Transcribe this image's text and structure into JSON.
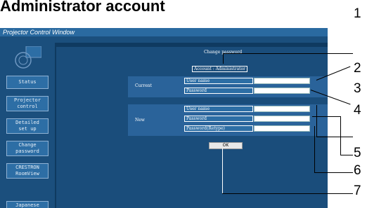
{
  "heading": "Administrator account",
  "window": {
    "title": "Projector Control Window"
  },
  "sidebar": {
    "items": [
      {
        "label": "Status"
      },
      {
        "label": "Projector\ncontrol"
      },
      {
        "label": "Detailed\nset up"
      },
      {
        "label": "Change\npassword"
      },
      {
        "label": "CRESTRON\nRoomView"
      },
      {
        "label": "Japanese"
      }
    ]
  },
  "main": {
    "page_title": "Change password",
    "account": "Account : Administrator",
    "current": {
      "section_label": "Current",
      "username_label": "User name",
      "password_label": "Password",
      "username_value": "",
      "password_value": ""
    },
    "new": {
      "section_label": "New",
      "username_label": "User name",
      "password_label": "Password",
      "retype_label": "Password(Retype)",
      "username_value": "",
      "password_value": "",
      "retype_value": ""
    },
    "ok_label": "OK"
  },
  "callouts": [
    "1",
    "2",
    "3",
    "4",
    "5",
    "6",
    "7"
  ],
  "colors": {
    "window_bg": "#1b4f7d",
    "titlebar": "#2a6aa0",
    "button_bg": "#2d6ea5"
  }
}
